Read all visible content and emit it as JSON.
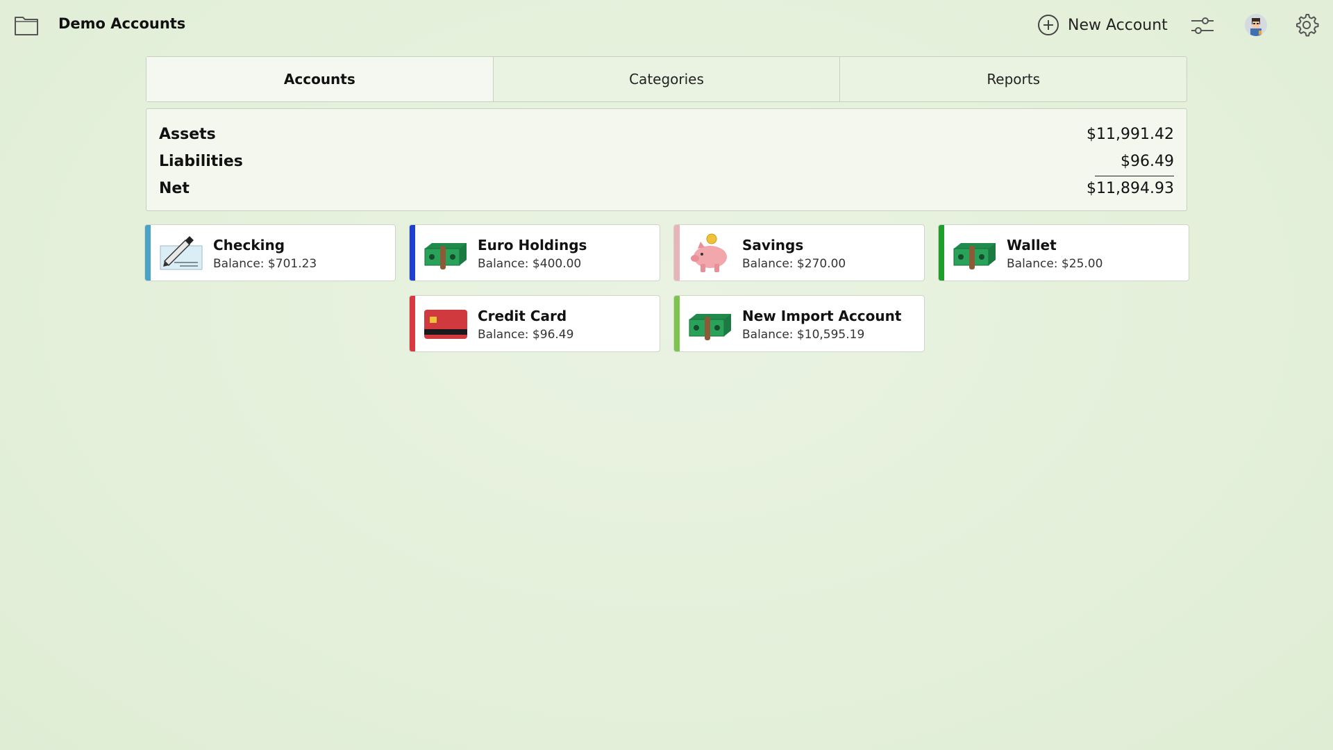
{
  "header": {
    "title": "Demo Accounts",
    "new_account_label": "New Account"
  },
  "tabs": [
    {
      "label": "Accounts",
      "active": true
    },
    {
      "label": "Categories",
      "active": false
    },
    {
      "label": "Reports",
      "active": false
    }
  ],
  "summary": {
    "assets_label": "Assets",
    "assets_value": "$11,991.42",
    "liabilities_label": "Liabilities",
    "liabilities_value": "$96.49",
    "net_label": "Net",
    "net_value": "$11,894.93"
  },
  "accounts": [
    {
      "name": "Checking",
      "balance": "Balance: $701.23",
      "color": "#4aa3c7",
      "icon": "check-icon"
    },
    {
      "name": "Euro Holdings",
      "balance": "Balance: $400.00",
      "color": "#1e3fd0",
      "icon": "cash-icon"
    },
    {
      "name": "Savings",
      "balance": "Balance: $270.00",
      "color": "#e7b4b8",
      "icon": "piggy-bank-icon"
    },
    {
      "name": "Wallet",
      "balance": "Balance: $25.00",
      "color": "#1f9e2c",
      "icon": "cash-icon"
    },
    {
      "name": "Credit Card",
      "balance": "Balance: $96.49",
      "color": "#d8393f",
      "icon": "credit-card-icon"
    },
    {
      "name": "New Import Account",
      "balance": "Balance: $10,595.19",
      "color": "#7cc44d",
      "icon": "cash-icon"
    }
  ]
}
